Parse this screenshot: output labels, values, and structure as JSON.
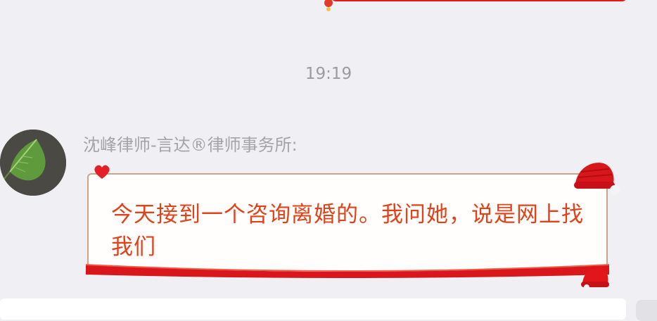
{
  "timestamp": "19:19",
  "message": {
    "sender": "沈峰律师-言达®律师事务所:",
    "text": "今天接到一个咨询离婚的。我问她，说是网上找我们",
    "text_color": "#e0421a",
    "bubble_accent": "#e01a1a"
  },
  "avatar": {
    "icon": "leaf"
  },
  "input": {
    "placeholder": ""
  }
}
